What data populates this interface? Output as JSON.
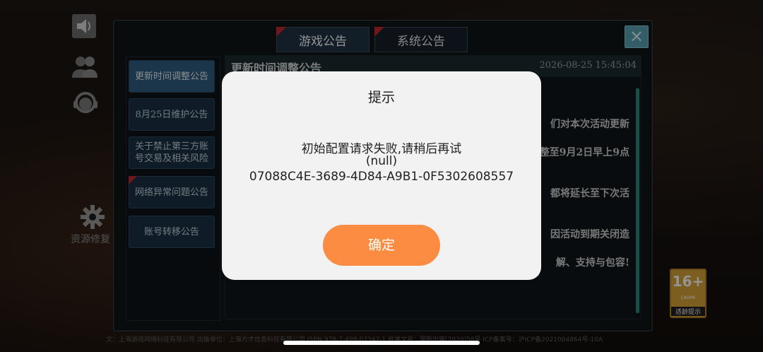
{
  "background": {
    "tabs": [
      {
        "label": "游戏公告",
        "active": true
      },
      {
        "label": "系统公告",
        "active": false
      }
    ],
    "close_icon": "×",
    "notices": [
      {
        "label": "更新时间调整公告",
        "active": true
      },
      {
        "label": "8月25日维护公告",
        "active": false
      },
      {
        "label": "关于禁止第三方账号交易及相关风险",
        "active": false
      },
      {
        "label": "网络异常问题公告",
        "active": false,
        "flag": true
      },
      {
        "label": "账号转移公告",
        "active": false
      }
    ],
    "content": {
      "title": "更新时间调整公告",
      "date": "2026-08-25  15:45:04",
      "visible_lines": [
        "们对本次活动更新",
        "整至9月2日早上9点",
        "都将延长至下次活",
        "因活动到期关闭造",
        "解、支持与包容!"
      ]
    },
    "side_label": "资源修复",
    "age_rating": {
      "number": "16+",
      "brand": "CADPA",
      "tip": "适龄提示"
    },
    "footer": "文：上海游戏网络科技有限公司  出版单位：上海方才信息科技有限公司  ISBN 978-7-498-07347-1  批准文号：国新出审[2020]58号  ICP备案号：沪ICP备2021004864号-10A",
    "accent_colors": {
      "flag": "#c0282e",
      "close": "#5aa2b1",
      "age_badge": "#d6a23a"
    }
  },
  "dialog": {
    "title": "提示",
    "message_lines": [
      "初始配置请求失败,请稍后再试",
      "(null)",
      "07088C4E-3689-4D84-A9B1-0F5302608557"
    ],
    "confirm_label": "确定",
    "confirm_color": "#fb8c41"
  }
}
